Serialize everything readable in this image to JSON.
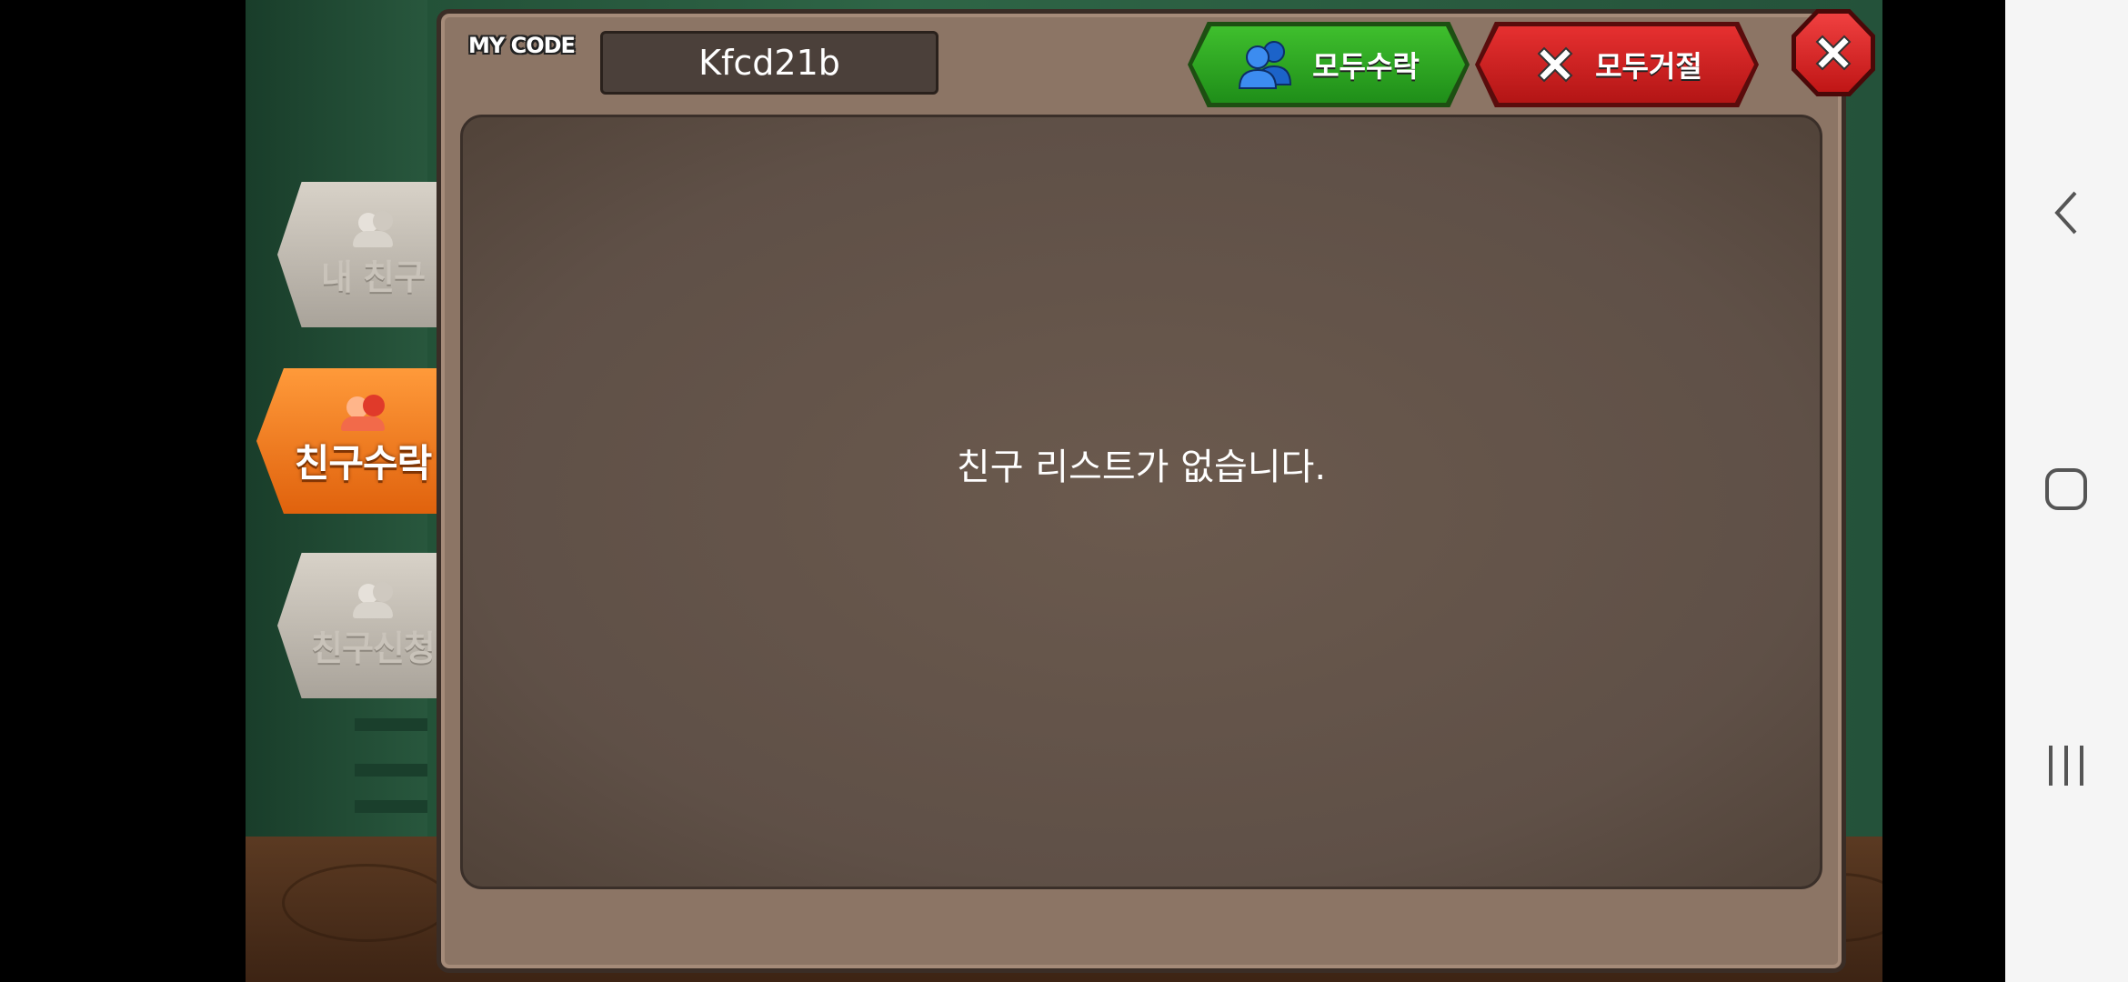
{
  "my_code": {
    "label": "MY CODE",
    "value": "Kfcd21b"
  },
  "actions": {
    "accept_all_label": "모두수락",
    "reject_all_label": "모두거절",
    "close_icon": "close-icon"
  },
  "tabs": [
    {
      "label": "내 친구",
      "icon": "friends-icon",
      "active": false
    },
    {
      "label": "친구수락",
      "icon": "friends-icon",
      "active": true
    },
    {
      "label": "친구신청",
      "icon": "friends-icon",
      "active": false
    }
  ],
  "list": {
    "empty_message": "친구 리스트가 없습니다."
  },
  "nav": {
    "back_icon": "back-icon",
    "home_icon": "home-icon",
    "recents_icon": "recents-icon"
  },
  "colors": {
    "accept": "#2aa31f",
    "reject": "#d01f1f",
    "active_tab": "#f07820",
    "panel": "#8c7565"
  }
}
